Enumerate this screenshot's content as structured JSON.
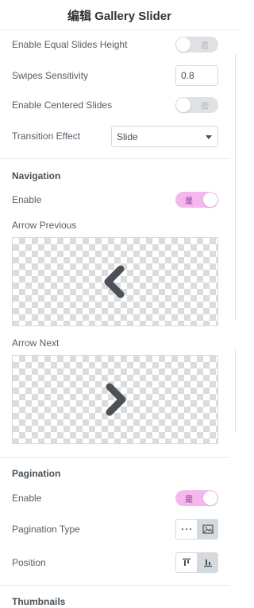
{
  "header": {
    "title": "编辑 Gallery Slider"
  },
  "settings": {
    "equal_height": {
      "label": "Enable Equal Slides Height",
      "state": "否"
    },
    "swipes": {
      "label": "Swipes Sensitivity",
      "value": "0.8"
    },
    "centered": {
      "label": "Enable Centered Slides",
      "state": "否"
    },
    "transition": {
      "label": "Transition Effect",
      "value": "Slide"
    }
  },
  "navigation": {
    "title": "Navigation",
    "enable_label": "Enable",
    "enable_state": "是",
    "arrow_prev_label": "Arrow Previous",
    "arrow_next_label": "Arrow Next"
  },
  "pagination": {
    "title": "Pagination",
    "enable_label": "Enable",
    "enable_state": "是",
    "type_label": "Pagination Type",
    "position_label": "Position"
  },
  "thumbnails": {
    "title": "Thumbnails"
  },
  "icons": {
    "arrow_prev": "chevron-left-icon",
    "arrow_next": "chevron-right-icon",
    "dots": "dots-icon",
    "image": "image-icon",
    "align_top": "align-top-icon",
    "align_bottom": "align-bottom-icon"
  },
  "colors": {
    "switch_on": "#f5b8ee",
    "switch_off": "#e0e1e3",
    "arrow": "#4b5157"
  }
}
